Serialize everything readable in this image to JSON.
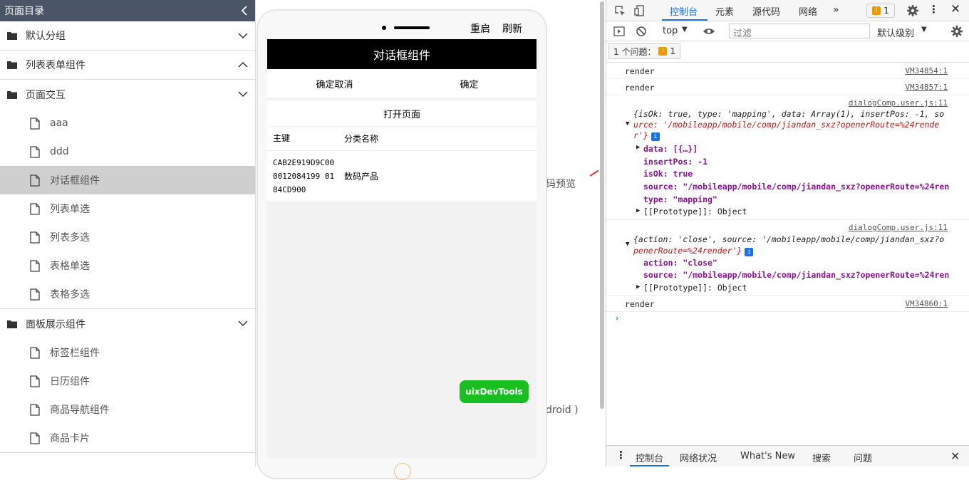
{
  "sidebar": {
    "title": "页面目录",
    "groups": [
      {
        "label": "默认分组",
        "items": []
      },
      {
        "label": "列表表单组件",
        "items": []
      },
      {
        "label": "页面交互",
        "items": [
          "aaa",
          "ddd",
          "对话框组件",
          "列表单选",
          "列表多选",
          "表格单选",
          "表格多选"
        ]
      },
      {
        "label": "面板展示组件",
        "items": [
          "标签栏组件",
          "日历组件",
          "商品导航组件",
          "商品卡片"
        ]
      }
    ]
  },
  "phone": {
    "restart": "重启",
    "refresh": "刷新",
    "title": "对话框组件",
    "btn_cancel_confirm": "确定取消",
    "btn_confirm": "确定",
    "open_page": "打开页面",
    "table_headers": [
      "主键",
      "分类名称"
    ],
    "table_rows": [
      [
        "CAB2E919D9C000012084199 0184CD900",
        "数码产品"
      ]
    ],
    "devtools_button": "uixDevTools",
    "behind_text_1": "码预览",
    "behind_text_2": "droid )"
  },
  "devtools": {
    "tabs": [
      "控制台",
      "元素",
      "源代码",
      "网络"
    ],
    "issue_badge": "1",
    "context": "top",
    "filter_placeholder": "过滤",
    "level": "默认级别",
    "issue_label": "1 个问题：",
    "issue_count": "1",
    "log": {
      "render1": "render",
      "render1_src": "VM34854:1",
      "render2": "render",
      "render2_src": "VM34857:1",
      "obj1_src": "dialogComp.user.js:11",
      "obj1_line1": "{isOk: true, type: 'mapping', data: Array(1), insertPos: -1, so",
      "obj1_line2": "urce: '/mobileapp/mobile/comp/jiandan_sxz?openerRoute=%24rende",
      "obj1_line3": "r'}",
      "obj1_data": "data: [{…}]",
      "obj1_insertPos": "insertPos: -1",
      "obj1_isOk": "isOk: true",
      "obj1_source": "source: \"/mobileapp/mobile/comp/jiandan_sxz?openerRoute=%24ren",
      "obj1_type": "type: \"mapping\"",
      "obj1_proto": "[[Prototype]]: Object",
      "obj2_src": "dialogComp.user.js:11",
      "obj2_line1": "{action: 'close', source: '/mobileapp/mobile/comp/jiandan_sxz?o",
      "obj2_line2": "penerRoute=%24render'}",
      "obj2_action": "action: \"close\"",
      "obj2_source": "source: \"/mobileapp/mobile/comp/jiandan_sxz?openerRoute=%24ren",
      "obj2_proto": "[[Prototype]]: Object",
      "render3": "render",
      "render3_src": "VM34860:1"
    },
    "bottom_tabs": [
      "控制台",
      "网络状况",
      "What's New",
      "搜索",
      "问题"
    ]
  }
}
